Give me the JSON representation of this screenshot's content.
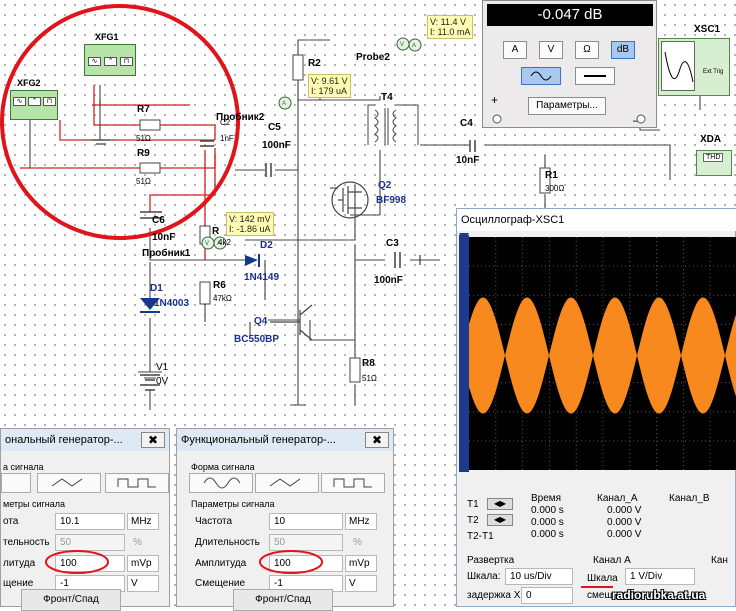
{
  "schematic": {
    "xfg1": "XFG1",
    "xfg2": "XFG2",
    "xsc1": "XSC1",
    "xda": "XDA",
    "thd": "THD",
    "ext_trig": "Ext Trig",
    "r7": {
      "ref": "R7",
      "val": "51Ω"
    },
    "r9": {
      "ref": "R9",
      "val": "51Ω"
    },
    "c6": {
      "ref": "C6",
      "val": "10nF"
    },
    "c2": {
      "ref": "C2",
      "val": "1nF"
    },
    "r2": "R2",
    "r1": {
      "ref": "R1",
      "val": "300Ω"
    },
    "r6": {
      "ref": "R6",
      "val": "47kΩ"
    },
    "r8": {
      "ref": "R8",
      "val": "51Ω"
    },
    "r_hidden": {
      "ref": "R",
      "val": "4k2"
    },
    "c5": {
      "ref": "C5",
      "val": "100nF"
    },
    "c4": {
      "ref": "C4",
      "val": "10nF"
    },
    "c3": {
      "ref": "C3",
      "val": "100nF"
    },
    "t4": "T4",
    "q2": {
      "ref": "Q2",
      "val": "BF998"
    },
    "q4": {
      "ref": "Q4",
      "val": "BC550BP"
    },
    "d1": {
      "ref": "D1",
      "val": "1N4003"
    },
    "d2": {
      "ref": "D2",
      "val": "1N4149"
    },
    "v1": {
      "ref": "V1",
      "val": "0V"
    },
    "probe2_en": "Probe2",
    "probe2_ru": "Пробник2",
    "probe1_ru": "Пробник1",
    "probe_a": {
      "v": "V: 11.4 V",
      "i": "I: 11.0 mA"
    },
    "probe_b": {
      "v": "V: 9.61 V",
      "i": "I: 179 uA"
    },
    "probe_c": {
      "v": "V: 142 mV",
      "i": "I: -1.86 uA"
    }
  },
  "multimeter": {
    "reading": "-0.047 dB",
    "buttons": [
      "A",
      "V",
      "Ω",
      "dB"
    ],
    "active": "dB",
    "params_button": "Параметры...",
    "plus": "+",
    "minus": "–"
  },
  "oscilloscope": {
    "title": "Осциллограф-XSC1",
    "table": {
      "headers": [
        "Время",
        "Канал_A",
        "Канал_B"
      ],
      "rows": [
        {
          "label": "T1",
          "time": "0.000 s",
          "a": "0.000 V",
          "b": ""
        },
        {
          "label": "T2",
          "time": "0.000 s",
          "a": "0.000 V",
          "b": ""
        },
        {
          "label": "T2-T1",
          "time": "0.000 s",
          "a": "0.000 V",
          "b": ""
        }
      ]
    },
    "sweep_label": "Развертка",
    "scale_label": "Шкала:",
    "scale_value": "10 us/Div",
    "delay_label": "задержка X",
    "delay_value": "0",
    "channel_a_label": "Канал A",
    "ch_scale_label": "Шкала",
    "ch_scale_value": "1  V/Div",
    "offset_label": "смеще",
    "kan_label": "Кан",
    "trace_color": "#f7891f"
  },
  "fg_left": {
    "title": "ональный генератор-...",
    "waveform_group": "а сигнала",
    "params_group": "метры сигнала",
    "rows": [
      {
        "label": "ота",
        "value": "10.1",
        "unit": "MHz"
      },
      {
        "label": "тельность",
        "value": "50",
        "unit": "%"
      },
      {
        "label": "литуда",
        "value": "100",
        "unit": "mVp"
      },
      {
        "label": "щение",
        "value": "-1",
        "unit": "V"
      }
    ],
    "front_button": "Фронт/Спад"
  },
  "fg_right": {
    "title": "Функциональный генератор-...",
    "waveform_group": "Форма сигнала",
    "params_group": "Параметры сигнала",
    "rows": [
      {
        "label": "Частота",
        "value": "10",
        "unit": "MHz"
      },
      {
        "label": "Длительность",
        "value": "50",
        "unit": "%"
      },
      {
        "label": "Амплитуда",
        "value": "100",
        "unit": "mVp"
      },
      {
        "label": "Смещение",
        "value": "-1",
        "unit": "V"
      }
    ],
    "front_button": "Фронт/Спад"
  },
  "close_glyph": "✖",
  "watermark": "radiorubka.at.ua",
  "annotation_color": "#e0151b"
}
